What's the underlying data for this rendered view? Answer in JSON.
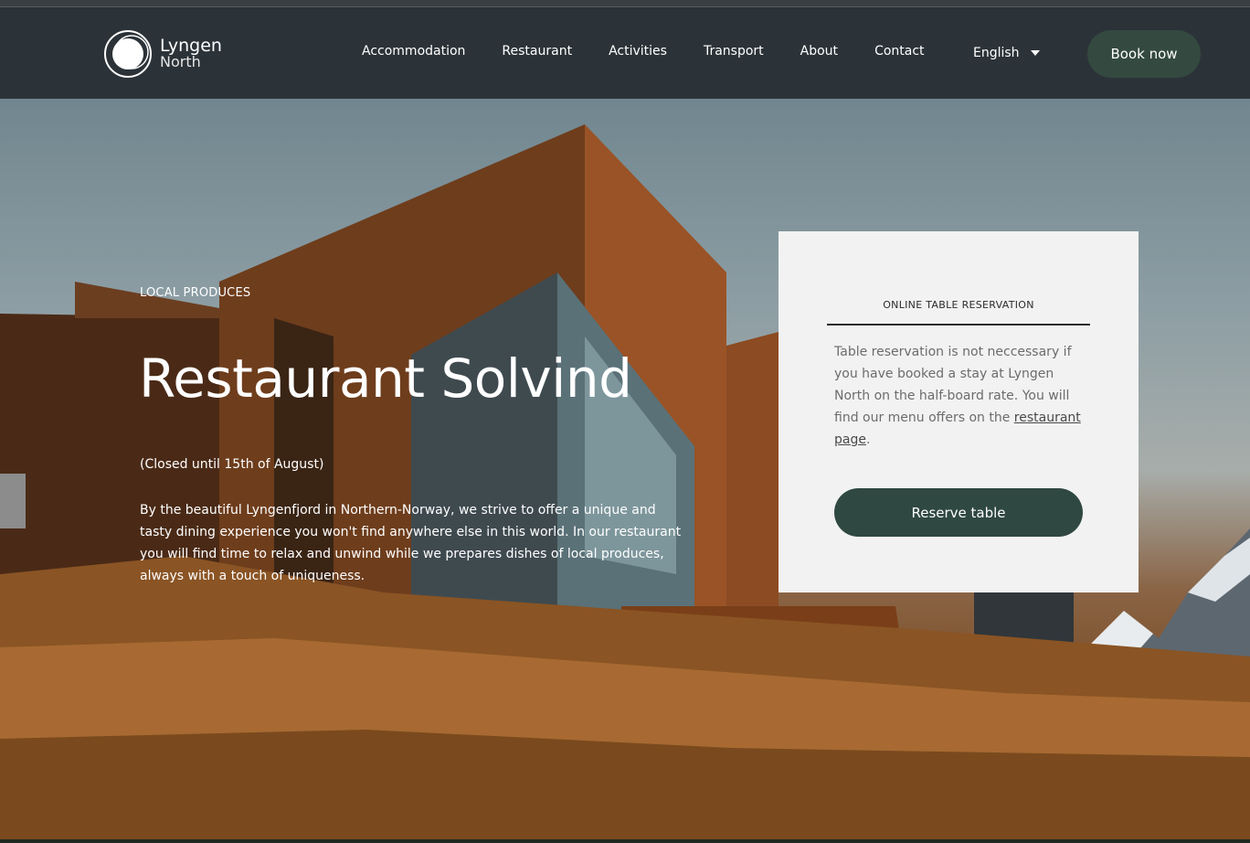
{
  "brand": {
    "name_line1": "Lyngen",
    "name_line2": "North"
  },
  "nav": {
    "items": [
      {
        "label": "Accommodation"
      },
      {
        "label": "Restaurant"
      },
      {
        "label": "Activities"
      },
      {
        "label": "Transport"
      },
      {
        "label": "About"
      },
      {
        "label": "Contact"
      }
    ],
    "language": "English",
    "book_label": "Book now"
  },
  "hero": {
    "eyebrow": "LOCAL PRODUCES",
    "title": "Restaurant Solvind",
    "closed_note": "(Closed until 15th of August)",
    "intro": "By the beautiful Lyngenfjord in Northern-Norway, we strive to offer a unique and tasty dining experience you won't find anywhere else in this world. In our restaurant you will find time to relax and unwind while we prepares dishes of local produces, always with a touch of uniqueness."
  },
  "reservation": {
    "title": "ONLINE TABLE RESERVATION",
    "text_before_link": "Table reservation is not neccessary if you have booked a stay at Lyngen North on the half-board rate. You will find our menu offers on the ",
    "link_label": "restaurant page",
    "text_after_link": ".",
    "button_label": "Reserve table"
  },
  "colors": {
    "nav_background": "#2c3338",
    "book_button": "#344a41",
    "reserve_button": "#2f4841",
    "card_background": "#f2f2f2"
  },
  "icons": {
    "language_toggle": "caret-down-icon"
  }
}
